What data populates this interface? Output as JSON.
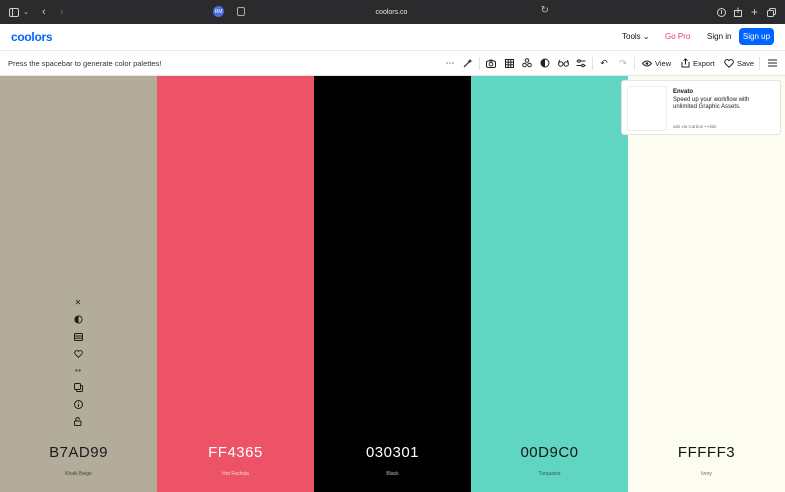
{
  "browser": {
    "url": "coolors.co",
    "extension_badge": "RM"
  },
  "nav": {
    "logo": "coolors",
    "tools_label": "Tools",
    "gopro_label": "Go Pro",
    "signin_label": "Sign in",
    "signup_label": "Sign up"
  },
  "toolbar": {
    "hint": "Press the spacebar to generate color palettes!",
    "view_label": "View",
    "export_label": "Export",
    "save_label": "Save"
  },
  "palette": [
    {
      "hex": "B7AD99",
      "name": "Khaki Beige",
      "color": "#b4ac9a",
      "text_color": "#1b1b1b",
      "name_color": "#4a463d"
    },
    {
      "hex": "FF4365",
      "name": "Hot Fuchsia",
      "color": "#ec5366",
      "text_color": "#ffffff",
      "name_color": "#fbd6dc"
    },
    {
      "hex": "030301",
      "name": "Black",
      "color": "#010101",
      "text_color": "#ffffff",
      "name_color": "#bfbfbf"
    },
    {
      "hex": "00D9C0",
      "name": "Turquoise",
      "color": "#5fd5c2",
      "text_color": "#151515",
      "name_color": "#2e5d55"
    },
    {
      "hex": "FFFFF3",
      "name": "Ivory",
      "color": "#fcfcf1",
      "text_color": "#151515",
      "name_color": "#6b6b63"
    }
  ],
  "ad": {
    "title": "Envato",
    "description": "Speed up your workflow with unlimited Graphic Assets.",
    "via": "ads via Carbon",
    "hide_label": "Hide"
  }
}
